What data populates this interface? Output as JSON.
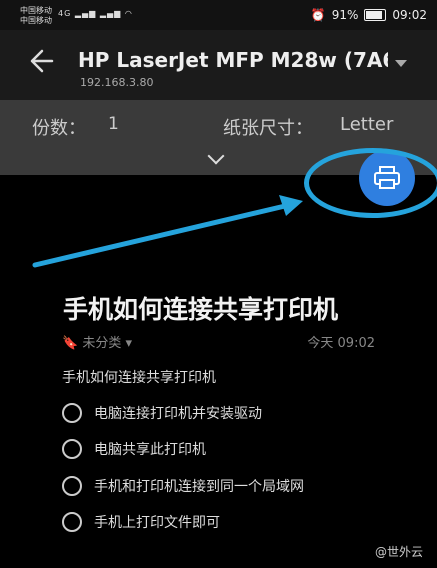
{
  "status_bar": {
    "carrier_1": "中国移动",
    "carrier_2": "中国移动",
    "network": "4G",
    "battery_text": "91%",
    "time": "09:02"
  },
  "print_header": {
    "back_icon": "arrow-left-icon",
    "printer_name": "HP LaserJet MFP M28w (7A6…",
    "printer_ip": "192.168.3.80",
    "dropdown_icon": "chevron-down-icon"
  },
  "print_settings": {
    "copies_label": "份数：",
    "copies_value": "1",
    "paper_size_label": "纸张尺寸：",
    "paper_size_value": "Letter",
    "expand_icon": "chevron-down-icon"
  },
  "fab": {
    "icon": "printer-icon",
    "color": "#2f7fe0"
  },
  "annotation": {
    "color": "#25a3dc"
  },
  "note": {
    "title": "手机如何连接共享打印机",
    "category": "未分类",
    "timestamp": "今天 09:02",
    "intro": "手机如何连接共享打印机",
    "checklist": [
      "电脑连接打印机并安装驱动",
      "电脑共享此打印机",
      "手机和打印机连接到同一个局域网",
      "手机上打印文件即可"
    ]
  },
  "watermark": "@世外云"
}
